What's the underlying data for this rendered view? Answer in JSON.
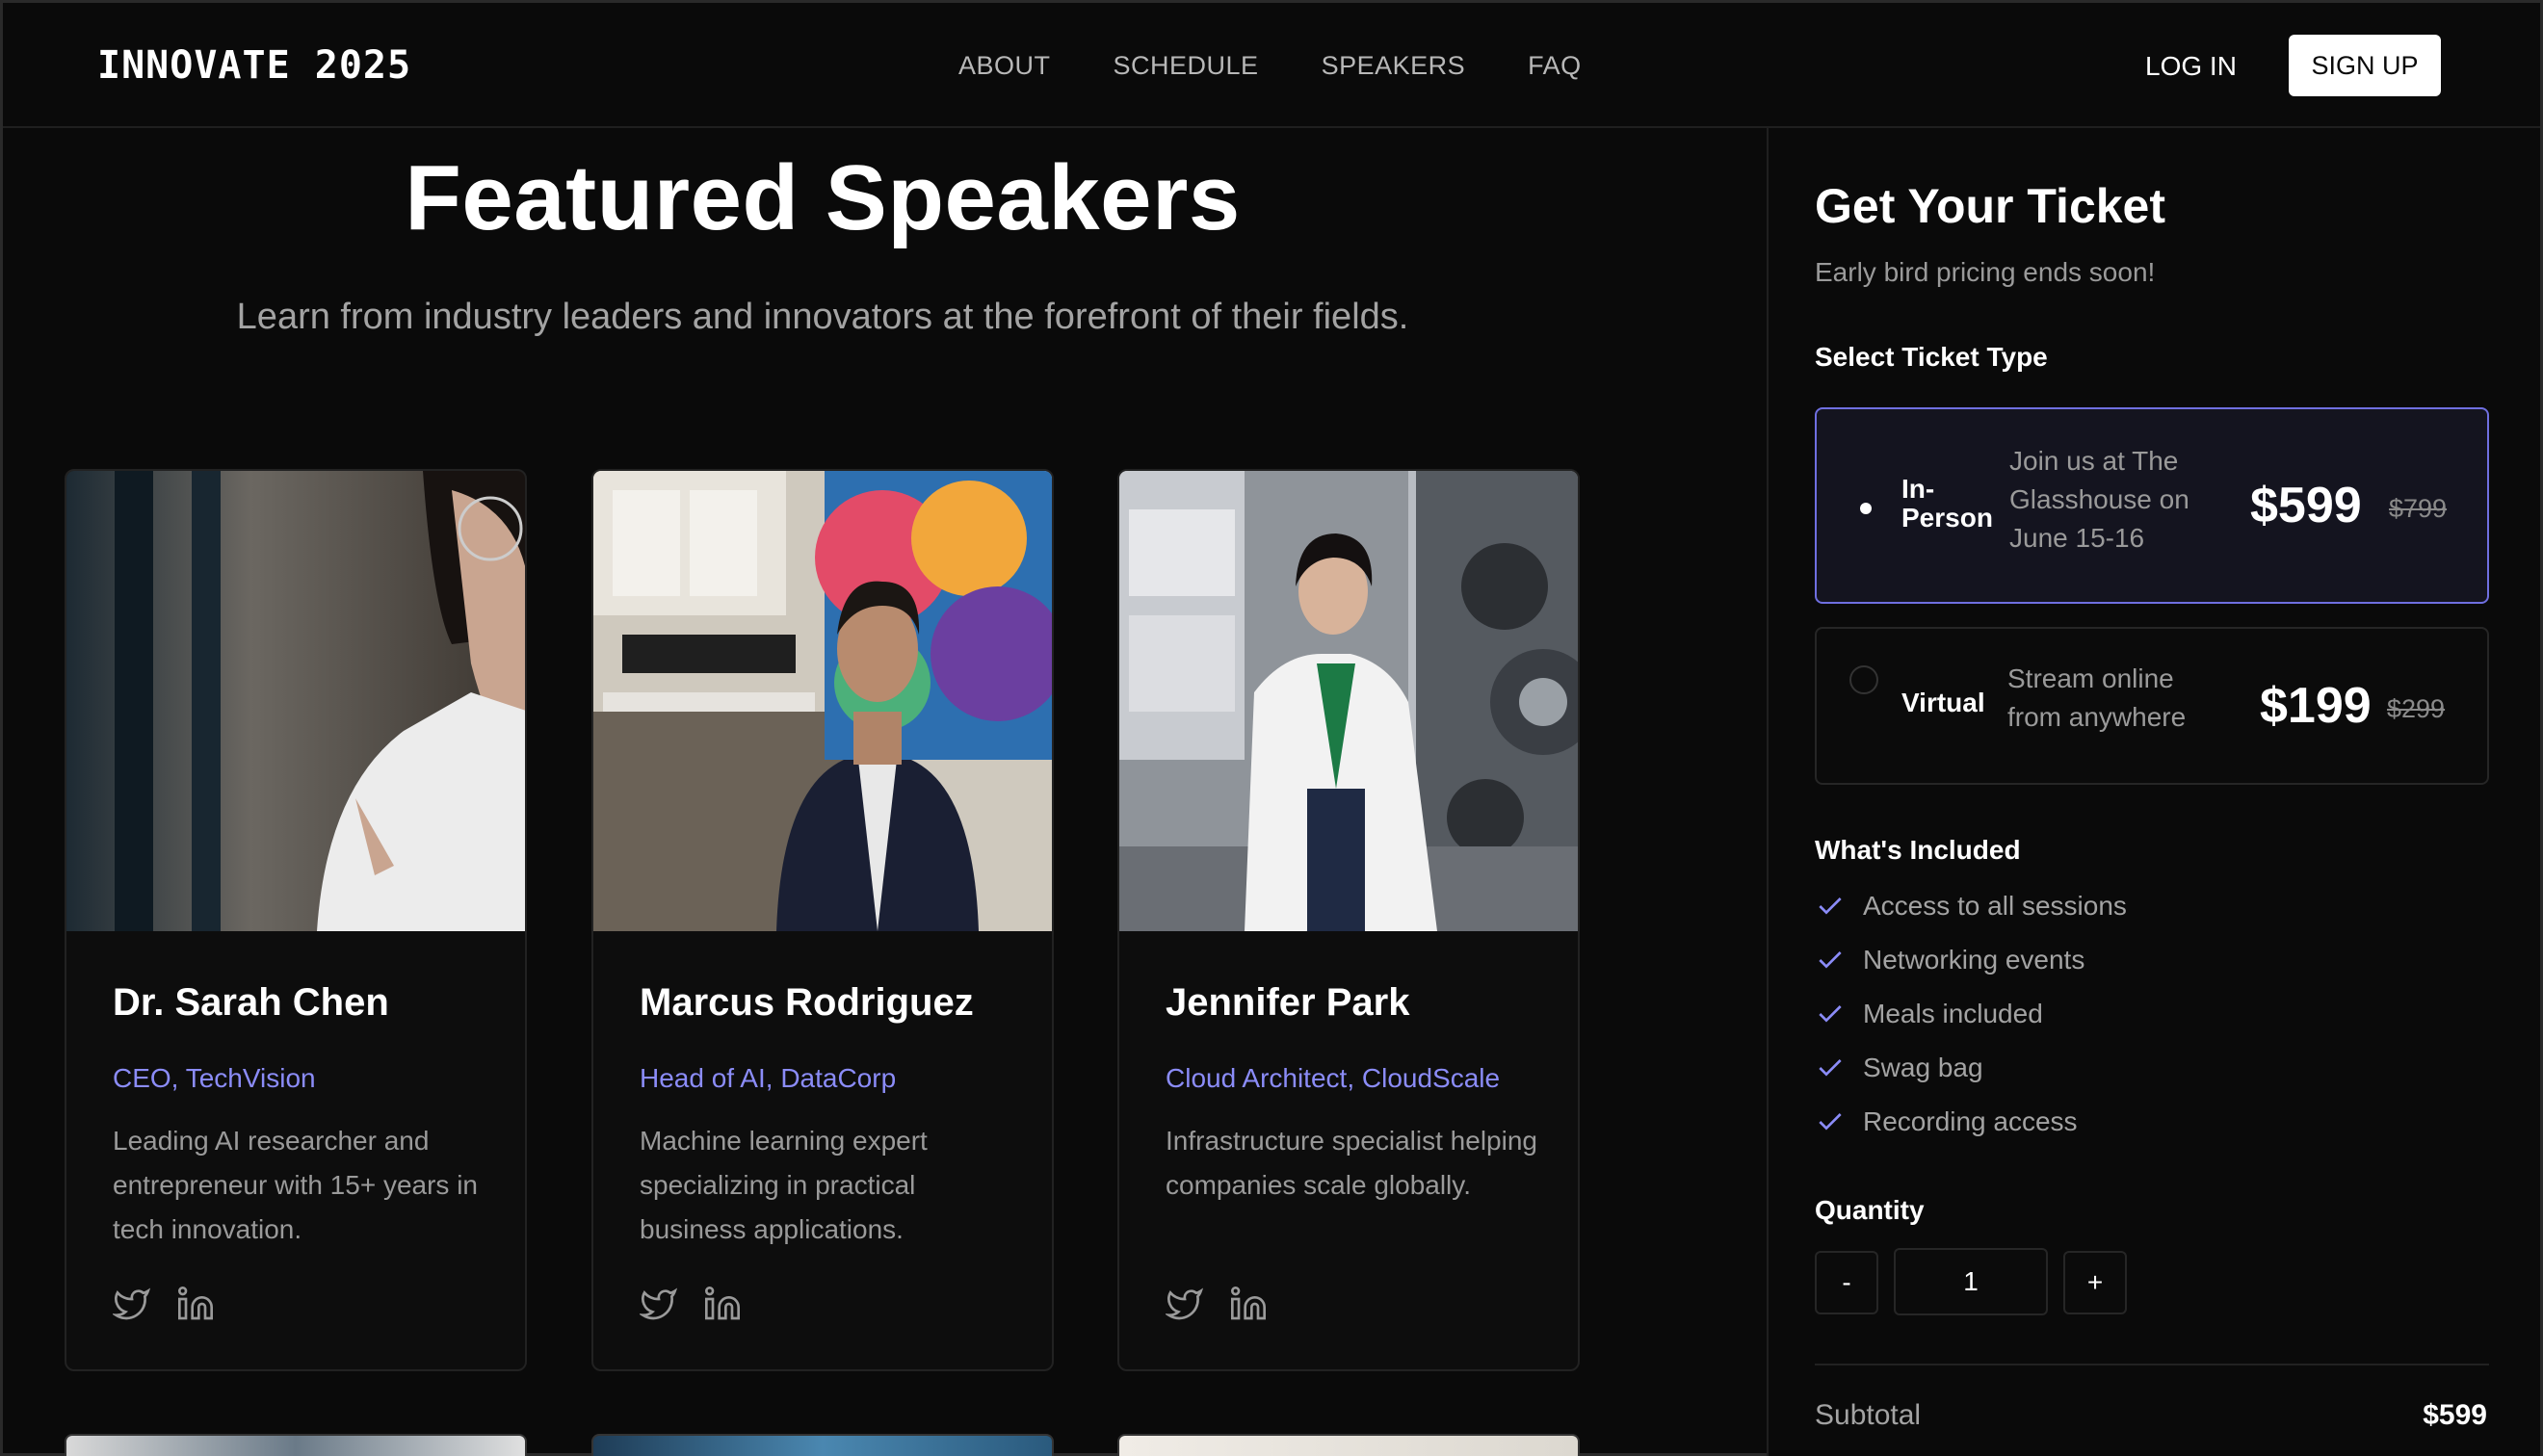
{
  "header": {
    "logo": "INNOVATE 2025",
    "nav": [
      "ABOUT",
      "SCHEDULE",
      "SPEAKERS",
      "FAQ"
    ],
    "login": "LOG IN",
    "signup": "SIGN UP"
  },
  "hero": {
    "title": "Featured Speakers",
    "subtitle": "Learn from industry leaders and innovators at the forefront of their fields."
  },
  "speakers": [
    {
      "name": "Dr. Sarah Chen",
      "role": "CEO, TechVision",
      "bio": "Leading AI researcher and entrepreneur with 15+ years in tech innovation.",
      "social": [
        "twitter-icon",
        "linkedin-icon"
      ]
    },
    {
      "name": "Marcus Rodriguez",
      "role": "Head of AI, DataCorp",
      "bio": "Machine learning expert specializing in practical business applications.",
      "social": [
        "twitter-icon",
        "linkedin-icon"
      ]
    },
    {
      "name": "Jennifer Park",
      "role": "Cloud Architect, CloudScale",
      "bio": "Infrastructure specialist helping companies scale globally.",
      "social": [
        "twitter-icon",
        "linkedin-icon"
      ]
    }
  ],
  "ticket": {
    "title": "Get Your Ticket",
    "subtitle": "Early bird pricing ends soon!",
    "select_label": "Select Ticket Type",
    "options": [
      {
        "name": "In-Person",
        "description": "Join us at The Glasshouse on June 15-16",
        "price": "$599",
        "original_price": "$799",
        "selected": true
      },
      {
        "name": "Virtual",
        "description": "Stream online from anywhere",
        "price": "$199",
        "original_price": "$299",
        "selected": false
      }
    ],
    "included_label": "What's Included",
    "included": [
      "Access to all sessions",
      "Networking events",
      "Meals included",
      "Swag bag",
      "Recording access"
    ],
    "quantity_label": "Quantity",
    "quantity": "1",
    "minus": "-",
    "plus": "+",
    "subtotal_label": "Subtotal",
    "subtotal": "$599"
  },
  "colors": {
    "background": "#0a0a0a",
    "accent": "#8b8cf8",
    "selected_border": "#6f6fe0"
  }
}
